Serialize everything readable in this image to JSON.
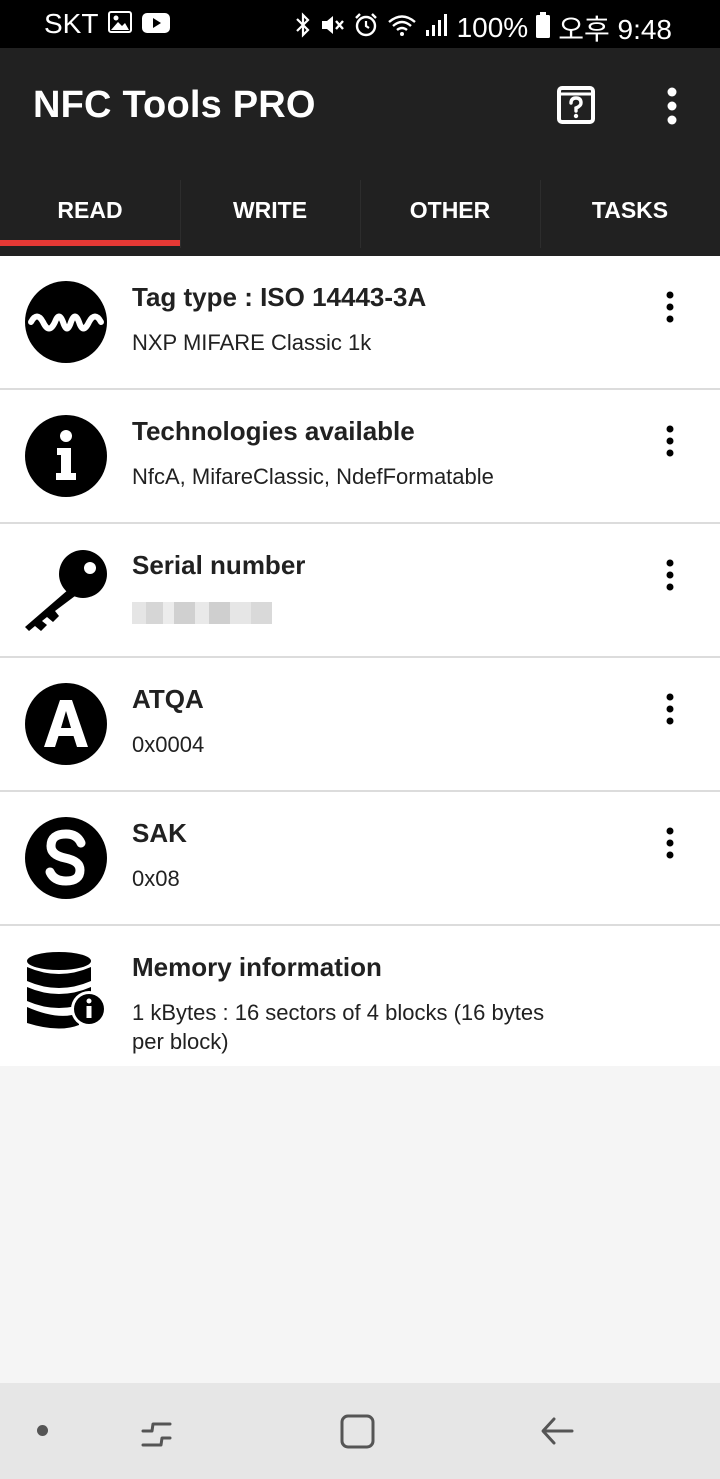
{
  "status_bar": {
    "carrier": "SKT",
    "battery": "100%",
    "time": "오후 9:48",
    "icons": [
      "image-icon",
      "youtube-icon",
      "bluetooth-icon",
      "mute-icon",
      "alarm-icon",
      "wifi-icon",
      "signal-icon",
      "battery-icon"
    ]
  },
  "app_bar": {
    "title": "NFC Tools PRO",
    "background": "#212121",
    "accent": "#e53935"
  },
  "tabs": [
    {
      "label": "READ",
      "active": true
    },
    {
      "label": "WRITE",
      "active": false
    },
    {
      "label": "OTHER",
      "active": false
    },
    {
      "label": "TASKS",
      "active": false
    }
  ],
  "items": [
    {
      "icon": "wave-icon",
      "title": "Tag type : ISO 14443-3A",
      "subtitle": "NXP MIFARE Classic 1k"
    },
    {
      "icon": "info-icon",
      "title": "Technologies available",
      "subtitle": "NfcA, MifareClassic, NdefFormatable"
    },
    {
      "icon": "key-icon",
      "title": "Serial number",
      "subtitle": ""
    },
    {
      "icon": "letter-a-icon",
      "title": "ATQA",
      "subtitle": "0x0004"
    },
    {
      "icon": "letter-s-icon",
      "title": "SAK",
      "subtitle": "0x08"
    },
    {
      "icon": "database-info-icon",
      "title": "Memory information",
      "subtitle": "1 kBytes : 16 sectors of 4 blocks (16 bytes per block)"
    }
  ]
}
